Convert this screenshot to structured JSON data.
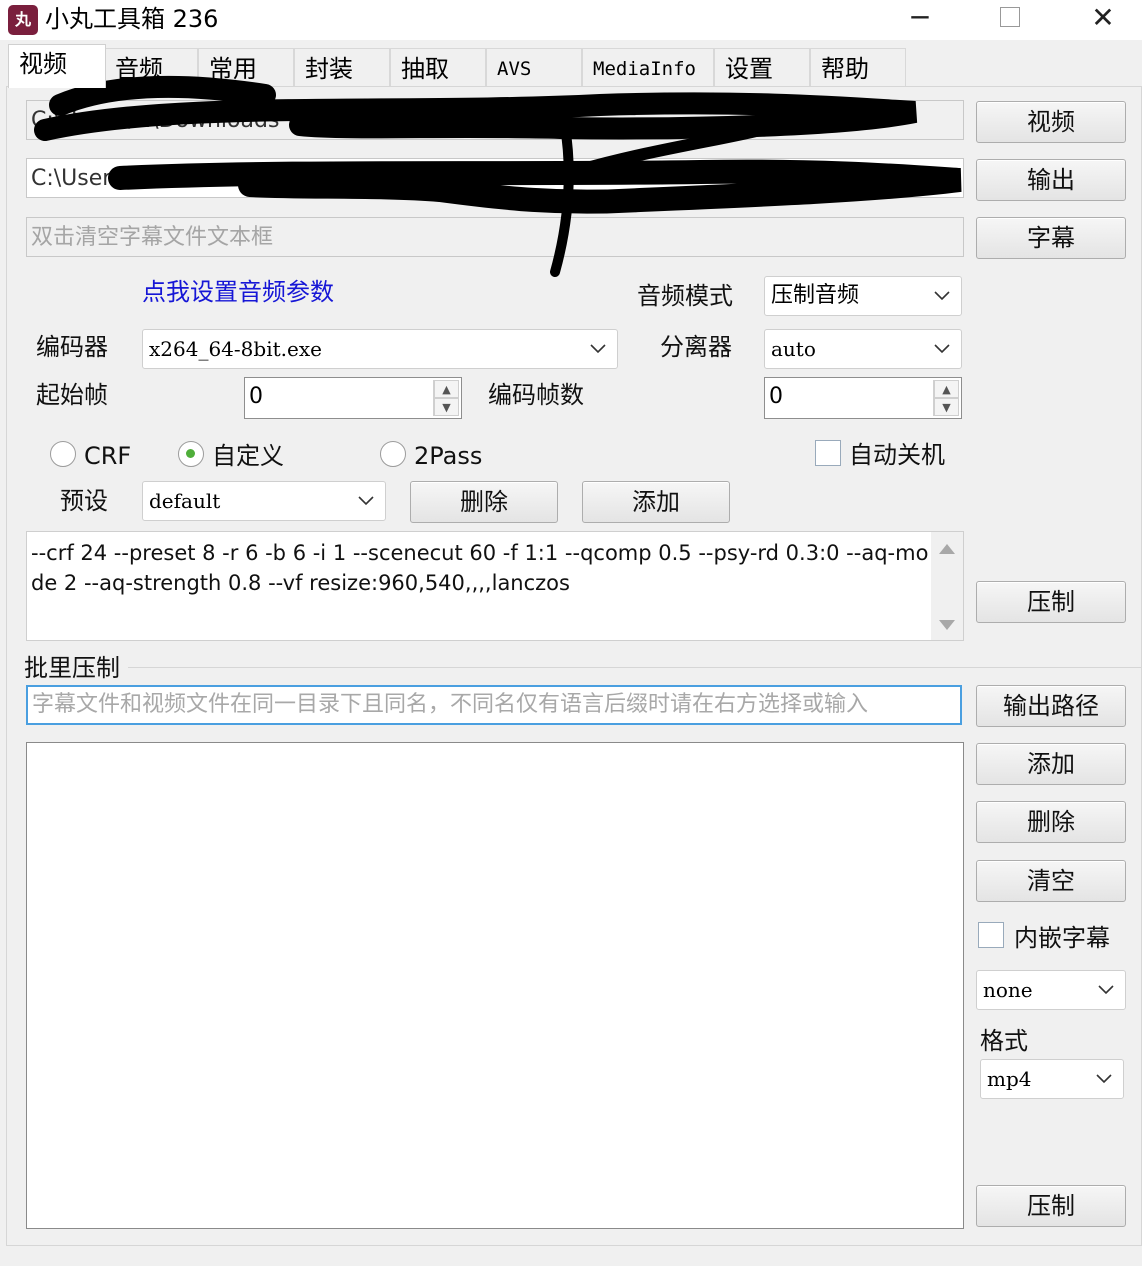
{
  "window": {
    "title": "小丸工具箱 236",
    "icon_text": "丸",
    "controls": {
      "minimize": "─",
      "close": "✕"
    }
  },
  "tabs": [
    {
      "label": "视频",
      "active": true
    },
    {
      "label": "音频"
    },
    {
      "label": "常用"
    },
    {
      "label": "封装"
    },
    {
      "label": "抽取"
    },
    {
      "label": "AVS"
    },
    {
      "label": "MediaInfo"
    },
    {
      "label": "设置"
    },
    {
      "label": "帮助"
    }
  ],
  "video": {
    "input_path": "C:\\Users\\...\\Downloads",
    "output_path": "C:\\Users",
    "subtitle_placeholder": "双击清空字幕文件文本框",
    "btn_video": "视频",
    "btn_output": "输出",
    "btn_subtitle": "字幕",
    "audio_link": "点我设置音频参数",
    "audio_mode_label": "音频模式",
    "audio_mode_value": "压制音频",
    "encoder_label": "编码器",
    "encoder_value": "x264_64-8bit.exe",
    "splitter_label": "分离器",
    "splitter_value": "auto",
    "start_frame_label": "起始帧",
    "start_frame_value": "0",
    "encode_frames_label": "编码帧数",
    "encode_frames_value": "0",
    "mode_crf": "CRF",
    "mode_custom": "自定义",
    "mode_2pass": "2Pass",
    "selected_mode": "自定义",
    "auto_shutdown_label": "自动关机",
    "auto_shutdown_checked": false,
    "preset_label": "预设",
    "preset_value": "default",
    "btn_delete": "删除",
    "btn_add": "添加",
    "params": "--crf 24 --preset 8 -r 6 -b 6 -i 1 --scenecut 60 -f 1:1 --qcomp 0.5 --psy-rd 0.3:0 --aq-mode 2 --aq-strength 0.8 --vf resize:960,540,,,,lanczos",
    "btn_encode": "压制"
  },
  "batch": {
    "group_label": "批里压制",
    "input_placeholder": "字幕文件和视频文件在同一目录下且同名，不同名仅有语言后缀时请在右方选择或输入",
    "btn_output_path": "输出路径",
    "btn_add": "添加",
    "btn_delete": "删除",
    "btn_clear": "清空",
    "embed_subtitle_label": "内嵌字幕",
    "embed_subtitle_checked": false,
    "subtitle_lang_value": "none",
    "format_label": "格式",
    "format_value": "mp4",
    "btn_encode": "压制"
  },
  "colors": {
    "link": "#1616d6",
    "focus_border": "#4a9fe0",
    "radio_selected": "#4fae3a",
    "icon_bg": "#7a1f3d"
  }
}
